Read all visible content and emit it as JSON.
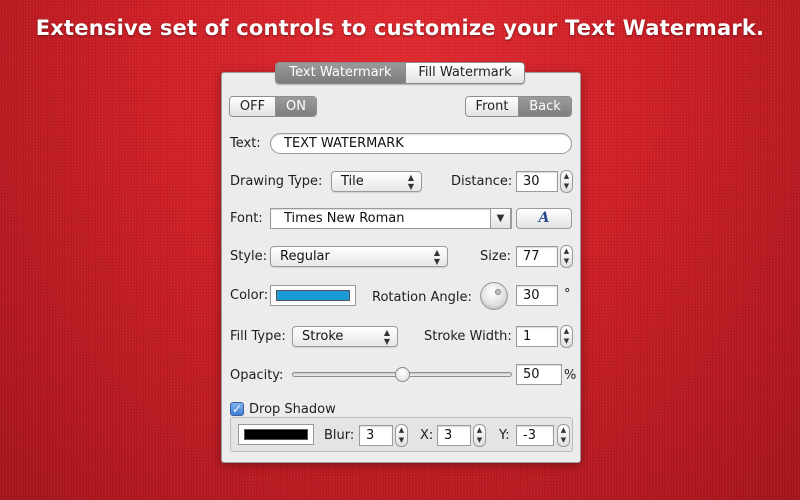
{
  "headline": "Extensive set of controls to customize your Text Watermark.",
  "tabs": [
    {
      "label": "Text Watermark",
      "active": true
    },
    {
      "label": "Fill Watermark",
      "active": false
    }
  ],
  "toggle": {
    "off_label": "OFF",
    "on_label": "ON",
    "selected": "ON"
  },
  "layer": {
    "front_label": "Front",
    "back_label": "Back",
    "selected": "Back"
  },
  "text": {
    "label": "Text:",
    "value": "TEXT WATERMARK"
  },
  "drawing_type": {
    "label": "Drawing Type:",
    "value": "Tile"
  },
  "distance": {
    "label": "Distance:",
    "value": "30"
  },
  "font": {
    "label": "Font:",
    "value": "Times New Roman",
    "button_glyph": "A"
  },
  "style": {
    "label": "Style:",
    "value": "Regular"
  },
  "size": {
    "label": "Size:",
    "value": "77"
  },
  "color": {
    "label": "Color:",
    "swatch": "#1a9ad6"
  },
  "rotation": {
    "label": "Rotation Angle:",
    "value": "30",
    "unit": "°"
  },
  "fill_type": {
    "label": "Fill Type:",
    "value": "Stroke"
  },
  "stroke_width": {
    "label": "Stroke Width:",
    "value": "1"
  },
  "opacity": {
    "label": "Opacity:",
    "value": "50",
    "unit": "%",
    "fraction": 0.5
  },
  "drop_shadow": {
    "label": "Drop Shadow",
    "checked": true,
    "swatch": "#000000",
    "blur_label": "Blur:",
    "blur": "3",
    "x_label": "X:",
    "x": "3",
    "y_label": "Y:",
    "y": "-3"
  }
}
